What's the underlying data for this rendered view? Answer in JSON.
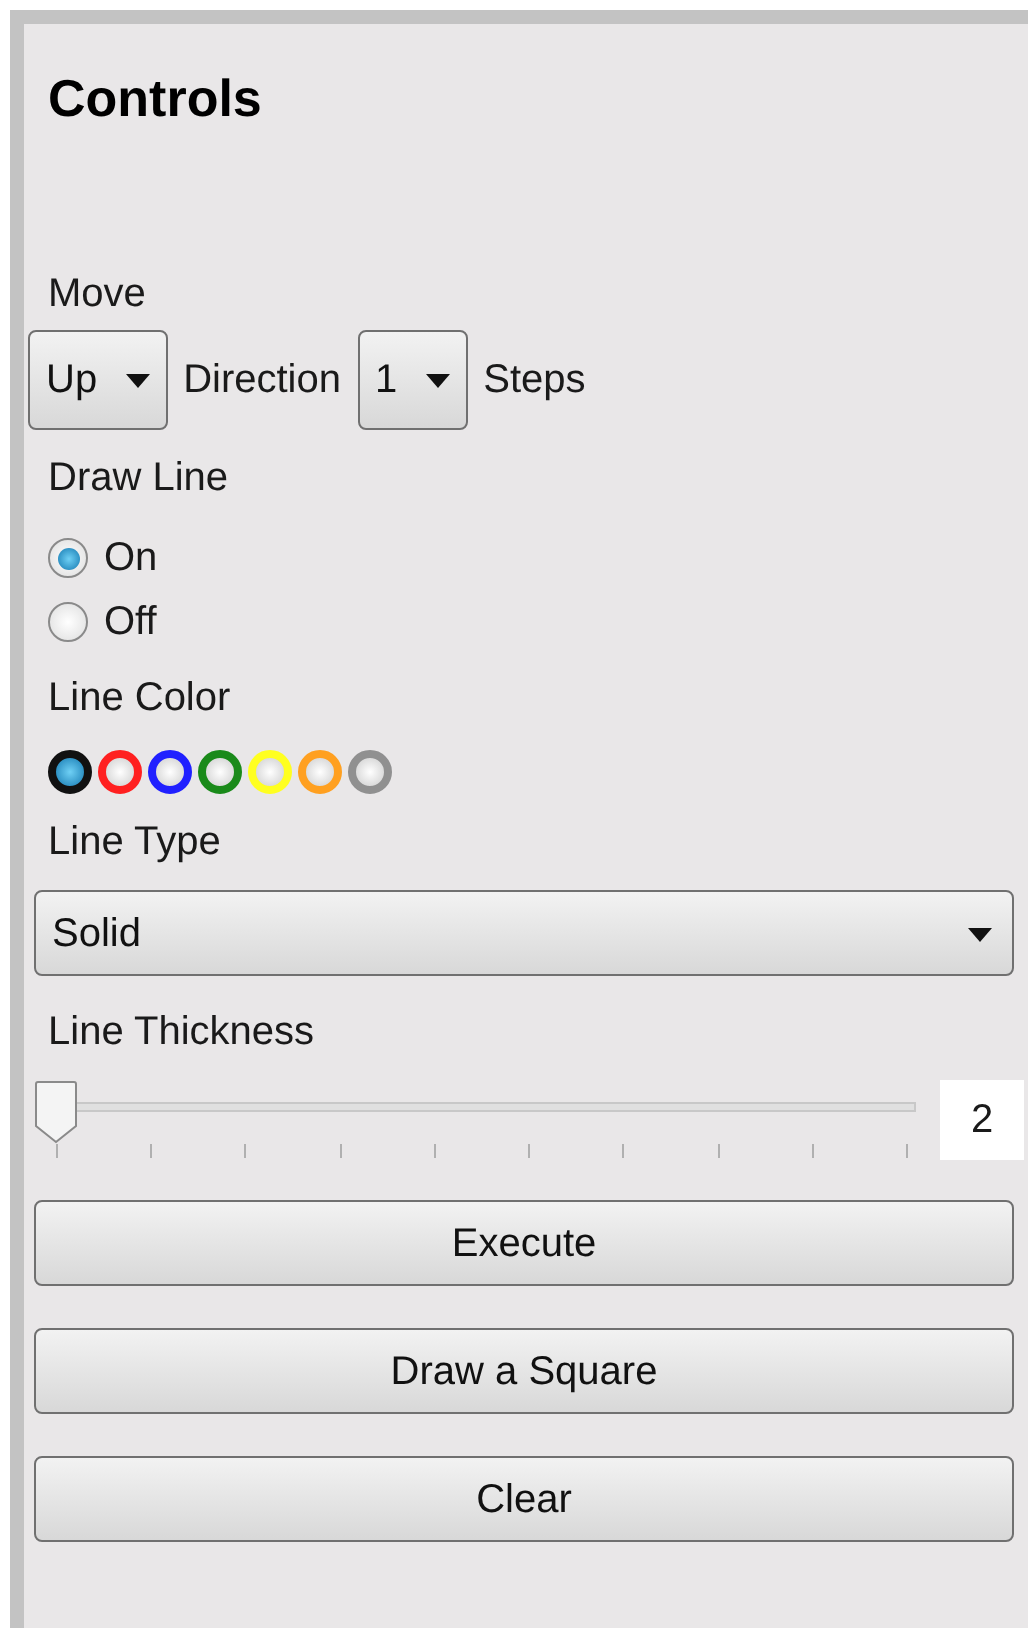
{
  "title": "Controls",
  "move": {
    "label": "Move",
    "direction": {
      "value": "Up"
    },
    "direction_label": "Direction",
    "steps": {
      "value": "1"
    },
    "steps_label": "Steps"
  },
  "draw_line": {
    "label": "Draw Line",
    "options": [
      {
        "label": "On",
        "selected": true
      },
      {
        "label": "Off",
        "selected": false
      }
    ]
  },
  "line_color": {
    "label": "Line Color",
    "swatches": [
      {
        "color": "#111111",
        "selected": true
      },
      {
        "color": "#ff2020",
        "selected": false
      },
      {
        "color": "#2020ff",
        "selected": false
      },
      {
        "color": "#1a8a1a",
        "selected": false
      },
      {
        "color": "#ffff20",
        "selected": false
      },
      {
        "color": "#ffa020",
        "selected": false
      },
      {
        "color": "#909090",
        "selected": false
      }
    ]
  },
  "line_type": {
    "label": "Line Type",
    "value": "Solid"
  },
  "line_thickness": {
    "label": "Line Thickness",
    "level": 0,
    "reading": "2"
  },
  "buttons": [
    "Execute",
    "Draw a Square",
    "Clear"
  ]
}
